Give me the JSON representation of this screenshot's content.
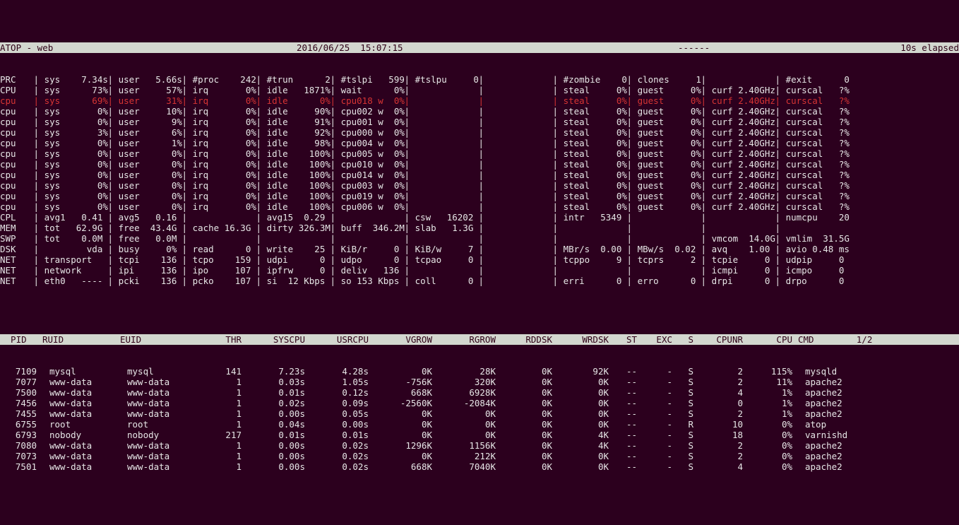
{
  "header": {
    "left": "ATOP - web",
    "center": "2016/06/25  15:07:15",
    "dash": "------",
    "right": "10s elapsed"
  },
  "sys_rows": [
    {
      "label": "PRC",
      "cells": [
        "sys    7.34s",
        "user   5.66s",
        "#proc    242",
        "#trun      2",
        "#tslpi   599",
        "#tslpu     0",
        "",
        "#zombie    0",
        "clones     1",
        "",
        "#exit      0"
      ]
    },
    {
      "label": "CPU",
      "cells": [
        "sys      73%",
        "user     57%",
        "irq       0%",
        "idle   1871%",
        "wait      0%",
        "",
        "",
        "steal     0%",
        "guest     0%",
        "curf 2.40GHz",
        "curscal   ?%"
      ]
    },
    {
      "label": "cpu",
      "red": true,
      "cells": [
        "sys      69%",
        "user     31%",
        "irq       0%",
        "idle      0%",
        "cpu018 w  0%",
        "",
        "",
        "steal     0%",
        "guest     0%",
        "curf 2.40GHz",
        "curscal   ?%"
      ]
    },
    {
      "label": "cpu",
      "cells": [
        "sys       0%",
        "user     10%",
        "irq       0%",
        "idle     90%",
        "cpu002 w  0%",
        "",
        "",
        "steal     0%",
        "guest     0%",
        "curf 2.40GHz",
        "curscal   ?%"
      ]
    },
    {
      "label": "cpu",
      "cells": [
        "sys       0%",
        "user      9%",
        "irq       0%",
        "idle     91%",
        "cpu001 w  0%",
        "",
        "",
        "steal     0%",
        "guest     0%",
        "curf 2.40GHz",
        "curscal   ?%"
      ]
    },
    {
      "label": "cpu",
      "cells": [
        "sys       3%",
        "user      6%",
        "irq       0%",
        "idle     92%",
        "cpu000 w  0%",
        "",
        "",
        "steal     0%",
        "guest     0%",
        "curf 2.40GHz",
        "curscal   ?%"
      ]
    },
    {
      "label": "cpu",
      "cells": [
        "sys       0%",
        "user      1%",
        "irq       0%",
        "idle     98%",
        "cpu004 w  0%",
        "",
        "",
        "steal     0%",
        "guest     0%",
        "curf 2.40GHz",
        "curscal   ?%"
      ]
    },
    {
      "label": "cpu",
      "cells": [
        "sys       0%",
        "user      0%",
        "irq       0%",
        "idle    100%",
        "cpu005 w  0%",
        "",
        "",
        "steal     0%",
        "guest     0%",
        "curf 2.40GHz",
        "curscal   ?%"
      ]
    },
    {
      "label": "cpu",
      "cells": [
        "sys       0%",
        "user      0%",
        "irq       0%",
        "idle    100%",
        "cpu010 w  0%",
        "",
        "",
        "steal     0%",
        "guest     0%",
        "curf 2.40GHz",
        "curscal   ?%"
      ]
    },
    {
      "label": "cpu",
      "cells": [
        "sys       0%",
        "user      0%",
        "irq       0%",
        "idle    100%",
        "cpu014 w  0%",
        "",
        "",
        "steal     0%",
        "guest     0%",
        "curf 2.40GHz",
        "curscal   ?%"
      ]
    },
    {
      "label": "cpu",
      "cells": [
        "sys       0%",
        "user      0%",
        "irq       0%",
        "idle    100%",
        "cpu003 w  0%",
        "",
        "",
        "steal     0%",
        "guest     0%",
        "curf 2.40GHz",
        "curscal   ?%"
      ]
    },
    {
      "label": "cpu",
      "cells": [
        "sys       0%",
        "user      0%",
        "irq       0%",
        "idle    100%",
        "cpu019 w  0%",
        "",
        "",
        "steal     0%",
        "guest     0%",
        "curf 2.40GHz",
        "curscal   ?%"
      ]
    },
    {
      "label": "cpu",
      "cells": [
        "sys       0%",
        "user      0%",
        "irq       0%",
        "idle    100%",
        "cpu006 w  0%",
        "",
        "",
        "steal     0%",
        "guest     0%",
        "curf 2.40GHz",
        "curscal   ?%"
      ]
    },
    {
      "label": "CPL",
      "cells": [
        "avg1   0.41",
        "avg5   0.16",
        "",
        "avg15  0.29",
        "",
        "csw   16202",
        "",
        "intr   5349",
        "",
        "",
        "numcpu    20"
      ]
    },
    {
      "label": "MEM",
      "cells": [
        "tot   62.9G",
        "free  43.4G",
        "cache 16.3G",
        "dirty 326.3M",
        "buff  346.2M",
        "slab   1.3G",
        "",
        "",
        "",
        "",
        ""
      ]
    },
    {
      "label": "SWP",
      "cells": [
        "tot    0.0M",
        "free   0.0M",
        "",
        "",
        "",
        "",
        "",
        "",
        "",
        "vmcom  14.0G",
        "vmlim  31.5G"
      ]
    },
    {
      "label": "DSK",
      "cells": [
        "        vda",
        "busy     0%",
        "read      0",
        "write    25",
        "KiB/r     0",
        "KiB/w     7",
        "",
        "MBr/s  0.00",
        "MBw/s  0.02",
        "avq    1.00",
        "avio 0.48 ms"
      ]
    },
    {
      "label": "NET",
      "cells": [
        "transport  ",
        "tcpi    136",
        "tcpo    159",
        "udpi      0",
        "udpo      0",
        "tcpao     0",
        "",
        "tcppo     9",
        "tcprs     2",
        "tcpie     0",
        "udpip     0"
      ]
    },
    {
      "label": "NET",
      "cells": [
        "network    ",
        "ipi     136",
        "ipo     107",
        "ipfrw     0",
        "deliv   136",
        "",
        "",
        "",
        "",
        "icmpi     0",
        "icmpo     0"
      ]
    },
    {
      "label": "NET",
      "cells": [
        "eth0   ----",
        "pcki    136",
        "pcko    107",
        "si  12 Kbps",
        "so 153 Kbps",
        "coll      0",
        "",
        "erri      0",
        "erro      0",
        "drpi      0",
        "drpo      0"
      ]
    }
  ],
  "proc_cols": [
    "  PID",
    "RUID    ",
    "EUID    ",
    "   THR",
    "  SYSCPU",
    "  USRCPU",
    "   VGROW",
    "   RGROW",
    "  RDDSK",
    "  WRDSK",
    "ST",
    "EXC",
    "S",
    " CPUNR",
    "   CPU",
    "CMD        1/2"
  ],
  "procs": [
    {
      "pid": "7109",
      "ruid": "mysql",
      "euid": "mysql",
      "thr": "141",
      "syscpu": "7.23s",
      "usrcpu": "4.28s",
      "vgrow": "0K",
      "rgrow": "28K",
      "rddsk": "0K",
      "wrdsk": "92K",
      "st": "--",
      "exc": "-",
      "s": "S",
      "cpunr": "2",
      "cpu": "115%",
      "cmd": "mysqld"
    },
    {
      "pid": "7077",
      "ruid": "www-data",
      "euid": "www-data",
      "thr": "1",
      "syscpu": "0.03s",
      "usrcpu": "1.05s",
      "vgrow": "-756K",
      "rgrow": "320K",
      "rddsk": "0K",
      "wrdsk": "0K",
      "st": "--",
      "exc": "-",
      "s": "S",
      "cpunr": "2",
      "cpu": "11%",
      "cmd": "apache2"
    },
    {
      "pid": "7500",
      "ruid": "www-data",
      "euid": "www-data",
      "thr": "1",
      "syscpu": "0.01s",
      "usrcpu": "0.12s",
      "vgrow": "668K",
      "rgrow": "6928K",
      "rddsk": "0K",
      "wrdsk": "0K",
      "st": "--",
      "exc": "-",
      "s": "S",
      "cpunr": "4",
      "cpu": "1%",
      "cmd": "apache2"
    },
    {
      "pid": "7456",
      "ruid": "www-data",
      "euid": "www-data",
      "thr": "1",
      "syscpu": "0.02s",
      "usrcpu": "0.09s",
      "vgrow": "-2560K",
      "rgrow": "-2084K",
      "rddsk": "0K",
      "wrdsk": "0K",
      "st": "--",
      "exc": "-",
      "s": "S",
      "cpunr": "0",
      "cpu": "1%",
      "cmd": "apache2"
    },
    {
      "pid": "7455",
      "ruid": "www-data",
      "euid": "www-data",
      "thr": "1",
      "syscpu": "0.00s",
      "usrcpu": "0.05s",
      "vgrow": "0K",
      "rgrow": "0K",
      "rddsk": "0K",
      "wrdsk": "0K",
      "st": "--",
      "exc": "-",
      "s": "S",
      "cpunr": "2",
      "cpu": "1%",
      "cmd": "apache2"
    },
    {
      "pid": "6755",
      "ruid": "root",
      "euid": "root",
      "thr": "1",
      "syscpu": "0.04s",
      "usrcpu": "0.00s",
      "vgrow": "0K",
      "rgrow": "0K",
      "rddsk": "0K",
      "wrdsk": "0K",
      "st": "--",
      "exc": "-",
      "s": "R",
      "cpunr": "10",
      "cpu": "0%",
      "cmd": "atop"
    },
    {
      "pid": "6793",
      "ruid": "nobody",
      "euid": "nobody",
      "thr": "217",
      "syscpu": "0.01s",
      "usrcpu": "0.01s",
      "vgrow": "0K",
      "rgrow": "0K",
      "rddsk": "0K",
      "wrdsk": "4K",
      "st": "--",
      "exc": "-",
      "s": "S",
      "cpunr": "18",
      "cpu": "0%",
      "cmd": "varnishd"
    },
    {
      "pid": "7080",
      "ruid": "www-data",
      "euid": "www-data",
      "thr": "1",
      "syscpu": "0.00s",
      "usrcpu": "0.02s",
      "vgrow": "1296K",
      "rgrow": "1156K",
      "rddsk": "0K",
      "wrdsk": "4K",
      "st": "--",
      "exc": "-",
      "s": "S",
      "cpunr": "2",
      "cpu": "0%",
      "cmd": "apache2"
    },
    {
      "pid": "7073",
      "ruid": "www-data",
      "euid": "www-data",
      "thr": "1",
      "syscpu": "0.00s",
      "usrcpu": "0.02s",
      "vgrow": "0K",
      "rgrow": "212K",
      "rddsk": "0K",
      "wrdsk": "0K",
      "st": "--",
      "exc": "-",
      "s": "S",
      "cpunr": "2",
      "cpu": "0%",
      "cmd": "apache2"
    },
    {
      "pid": "7501",
      "ruid": "www-data",
      "euid": "www-data",
      "thr": "1",
      "syscpu": "0.00s",
      "usrcpu": "0.02s",
      "vgrow": "668K",
      "rgrow": "7040K",
      "rddsk": "0K",
      "wrdsk": "0K",
      "st": "--",
      "exc": "-",
      "s": "S",
      "cpunr": "4",
      "cpu": "0%",
      "cmd": "apache2"
    }
  ]
}
